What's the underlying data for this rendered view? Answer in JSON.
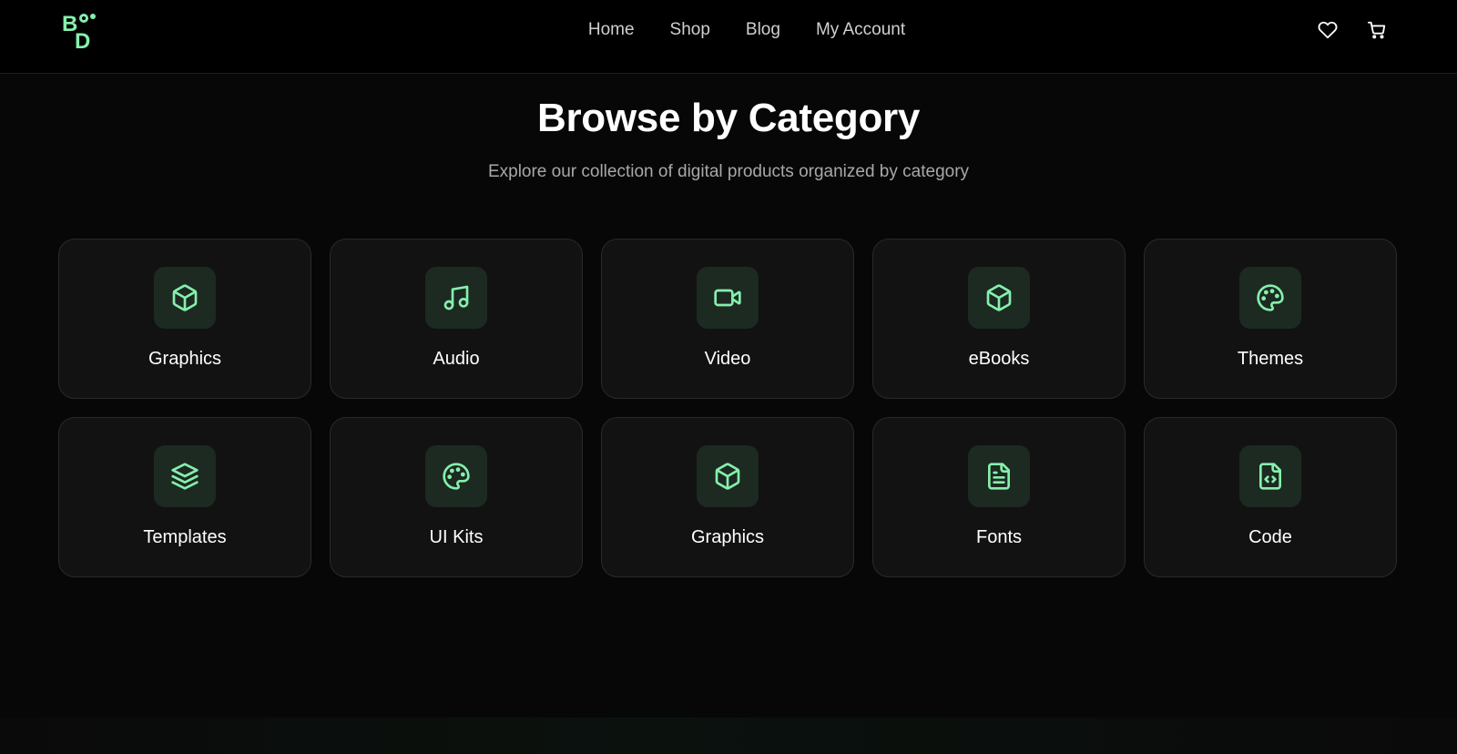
{
  "header": {
    "logo_text": "B D",
    "nav": [
      "Home",
      "Shop",
      "Blog",
      "My Account"
    ],
    "icons": [
      "heart-icon",
      "cart-icon"
    ]
  },
  "hero": {
    "title": "Browse by Category",
    "subtitle": "Explore our collection of digital products organized by category"
  },
  "categories": [
    {
      "label": "Graphics",
      "icon": "box-icon"
    },
    {
      "label": "Audio",
      "icon": "music-icon"
    },
    {
      "label": "Video",
      "icon": "video-icon"
    },
    {
      "label": "eBooks",
      "icon": "box-icon"
    },
    {
      "label": "Themes",
      "icon": "palette-icon"
    },
    {
      "label": "Templates",
      "icon": "layers-icon"
    },
    {
      "label": "UI Kits",
      "icon": "palette-icon"
    },
    {
      "label": "Graphics",
      "icon": "box-icon"
    },
    {
      "label": "Fonts",
      "icon": "file-text-icon"
    },
    {
      "label": "Code",
      "icon": "file-code-icon"
    }
  ],
  "colors": {
    "accent": "#86efac",
    "background": "#070707",
    "card": "#121212",
    "icon_bg": "#1c2a22"
  }
}
